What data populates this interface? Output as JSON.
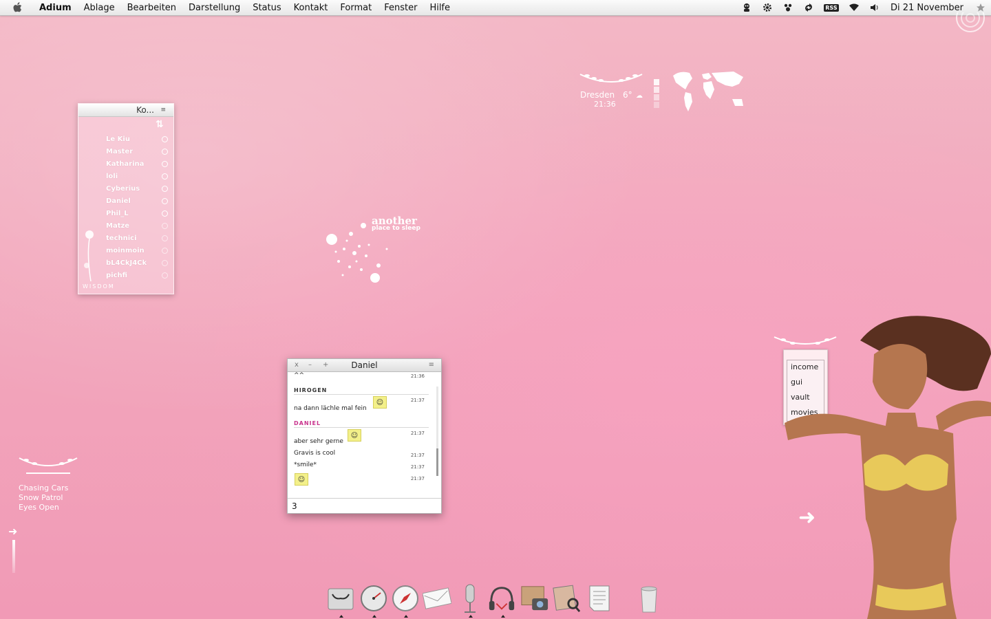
{
  "menubar": {
    "app": "Adium",
    "items": [
      "Ablage",
      "Bearbeiten",
      "Darstellung",
      "Status",
      "Kontakt",
      "Format",
      "Fenster",
      "Hilfe"
    ],
    "status_icons": [
      "adium-duck-icon",
      "gear-icon",
      "paw-icon",
      "sync-icon",
      "rss-icon",
      "wifi-icon",
      "volume-icon"
    ],
    "rss_label": "RSS",
    "clock": "Di 21 November"
  },
  "contacts": {
    "title": "Ko...",
    "footer": "WISDOM",
    "list": [
      {
        "name": "Le Kiu",
        "online": true
      },
      {
        "name": "Master",
        "online": true
      },
      {
        "name": "Katharina",
        "online": true
      },
      {
        "name": "loli",
        "online": true
      },
      {
        "name": "Cyberius",
        "online": true
      },
      {
        "name": "Daniel",
        "online": true
      },
      {
        "name": "Phil_L",
        "online": true
      },
      {
        "name": "Matze",
        "online": false
      },
      {
        "name": "technici",
        "online": false
      },
      {
        "name": "moinmoin",
        "online": false
      },
      {
        "name": "bL4CkJ4Ck",
        "online": false
      },
      {
        "name": "pichfi",
        "online": false
      }
    ]
  },
  "chat": {
    "title": "Daniel",
    "buttons": {
      "close": "x",
      "minimize": "–",
      "zoom": "+",
      "menu": "≡"
    },
    "messages": [
      {
        "text": "^^",
        "time": "21:36"
      },
      {
        "sender": "HIROGEN"
      },
      {
        "text": "na dann lächle mal fein",
        "time": "21:37"
      },
      {
        "sender": "DANIEL"
      },
      {
        "text": "aber sehr gerne",
        "time": "21:37"
      },
      {
        "text": "Gravis is cool",
        "time": "21:37"
      },
      {
        "text": "*smile*",
        "time": "21:37"
      },
      {
        "text": "",
        "time": "21:37"
      }
    ],
    "input_value": "3",
    "colors": {
      "hirogen": "#333333",
      "daniel": "#c8328c"
    }
  },
  "weather": {
    "city": "Dresden",
    "temp": "6°",
    "time": "21:36"
  },
  "another": {
    "big": "another",
    "small": "place to sleep"
  },
  "itunes": {
    "track": "Chasing Cars",
    "artist": "Snow Patrol",
    "album": "Eyes Open"
  },
  "folders": [
    "income",
    "gui",
    "vault",
    "movies"
  ],
  "dock": [
    {
      "name": "finder-icon",
      "running": true
    },
    {
      "name": "dashboard-icon",
      "running": true
    },
    {
      "name": "safari-icon",
      "running": true
    },
    {
      "name": "mail-icon",
      "running": false
    },
    {
      "name": "microphone-icon",
      "running": true
    },
    {
      "name": "itunes-headphones-icon",
      "running": true
    },
    {
      "name": "iphoto-icon",
      "running": false
    },
    {
      "name": "preview-icon",
      "running": false
    },
    {
      "name": "textedit-icon",
      "running": false
    },
    {
      "name": "trash-icon",
      "running": false
    }
  ]
}
